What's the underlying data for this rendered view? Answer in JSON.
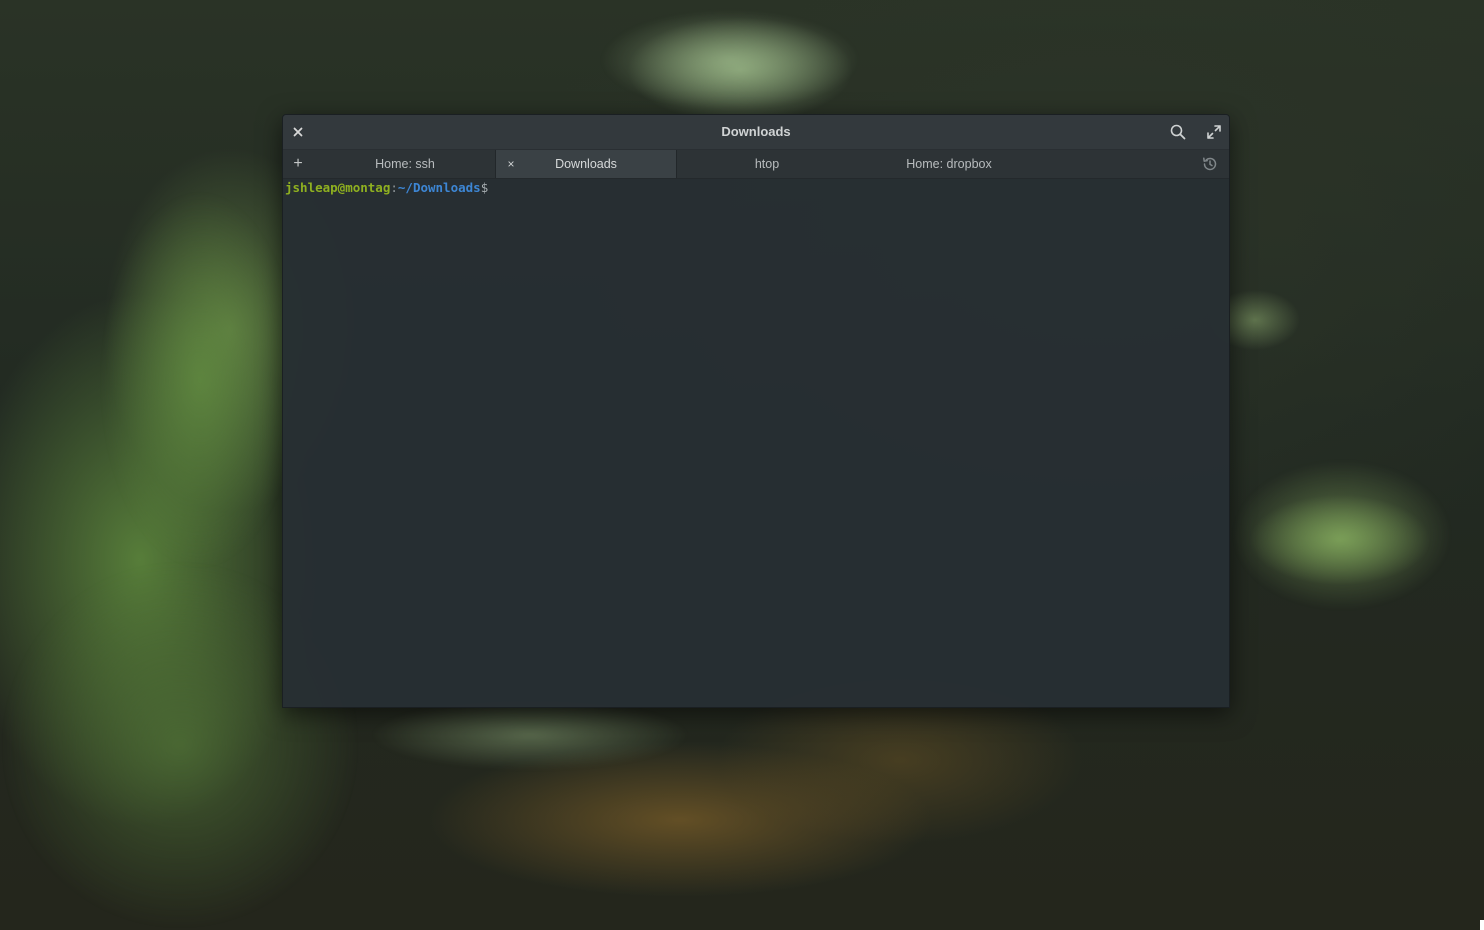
{
  "window": {
    "title": "Downloads",
    "close_icon": "close-icon",
    "search_icon": "search-icon",
    "fullscreen_icon": "fullscreen-icon"
  },
  "tabs": {
    "new_tab_label": "+",
    "items": [
      {
        "label": "Home: ssh",
        "active": false
      },
      {
        "label": "Downloads",
        "active": true,
        "close_label": "×"
      },
      {
        "label": "htop",
        "active": false
      },
      {
        "label": "Home: dropbox",
        "active": false
      }
    ],
    "history_icon": "history-icon"
  },
  "terminal": {
    "user_host": "jshleap@montag",
    "separator": ":",
    "path": "~/Downloads",
    "prompt_symbol": "$"
  },
  "colors": {
    "user_host": "#8fb020",
    "path": "#3d86d4",
    "background": "#262e32"
  }
}
